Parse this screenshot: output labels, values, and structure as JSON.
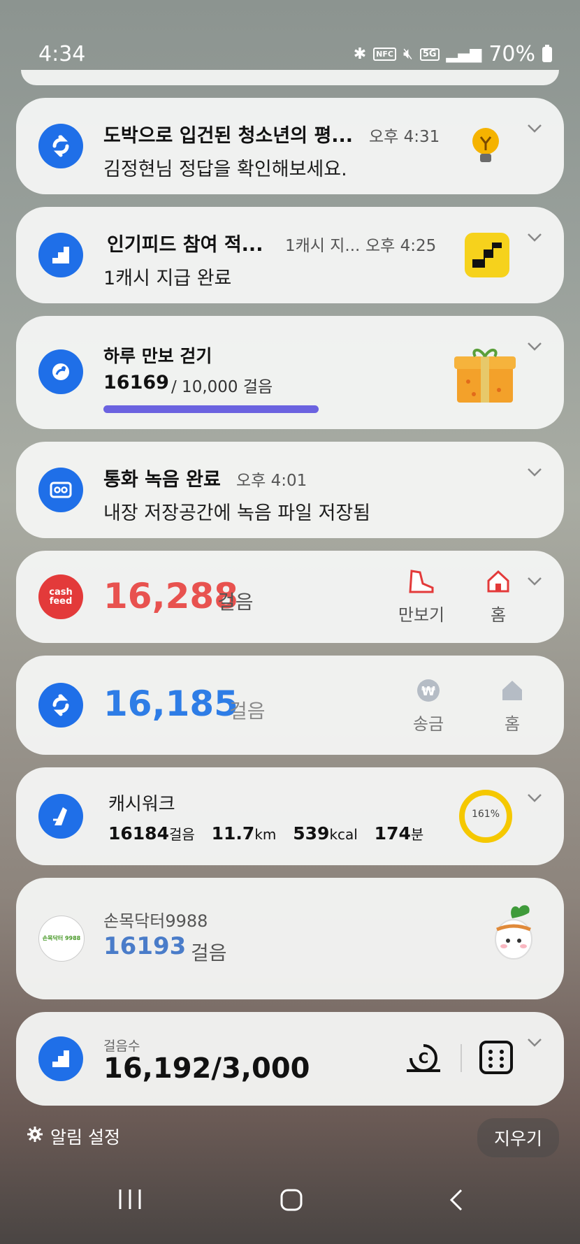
{
  "status_bar": {
    "time": "4:34",
    "battery": "70%",
    "nfc": "NFC",
    "network": "5G"
  },
  "notifications": [
    {
      "title": "도박으로 입건된 청소년의 평...",
      "time": "오후 4:31",
      "text": "김정현님 정답을 확인해보세요."
    },
    {
      "title": "인기피드 참여 적...",
      "subtitle": "1캐시 지...",
      "time": "오후 4:25",
      "text": "1캐시 지급 완료"
    },
    {
      "title": "하루 만보 걷기",
      "steps": "16169",
      "goal": "/ 10,000 걸음",
      "progress": 1.0
    },
    {
      "title": "통화 녹음 완료",
      "time": "오후 4:01",
      "text": "내장 저장공간에 녹음 파일 저장됨"
    },
    {
      "app_icon_text": "cash\nfeed",
      "steps": "16,288",
      "unit": "걸음",
      "actions": [
        "만보기",
        "홈"
      ]
    },
    {
      "steps": "16,185",
      "unit": "걸음",
      "actions": [
        "송금",
        "홈"
      ]
    },
    {
      "title": "캐시워크",
      "stats": {
        "steps": "16184",
        "steps_unit": "걸음",
        "km": "11.7",
        "km_unit": "km",
        "kcal": "539",
        "kcal_unit": "kcal",
        "minutes": "174",
        "minutes_unit": "분"
      },
      "ring_percent": "161%",
      "ring_value": 161
    },
    {
      "title": "손목닥터9988",
      "steps": "16193",
      "unit": "걸음",
      "logo_text": "손목닥터 9988"
    },
    {
      "label": "걸음수",
      "value": "16,192/3,000"
    }
  ],
  "footer": {
    "settings_label": "알림 설정",
    "clear_label": "지우기"
  },
  "colors": {
    "accent_blue": "#1f6fe8",
    "cashfeed_red": "#e8524f",
    "progress_purple": "#6b63e0",
    "ring_yellow": "#f5c800"
  }
}
